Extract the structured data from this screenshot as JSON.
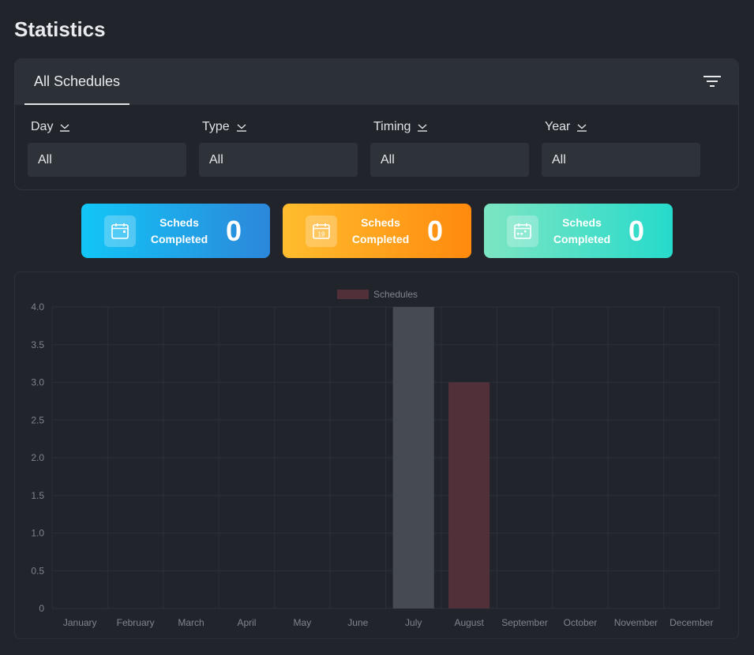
{
  "page": {
    "title": "Statistics"
  },
  "filters": {
    "tab_label": "All Schedules",
    "groups": [
      {
        "label": "Day",
        "value": "All"
      },
      {
        "label": "Type",
        "value": "All"
      },
      {
        "label": "Timing",
        "value": "All"
      },
      {
        "label": "Year",
        "value": "All"
      }
    ]
  },
  "stats": [
    {
      "label_line1": "Scheds",
      "label_line2": "Completed",
      "value": "0",
      "icon": "calendar-blank-icon"
    },
    {
      "label_line1": "Scheds",
      "label_line2": "Completed",
      "value": "0",
      "icon": "calendar-19-icon"
    },
    {
      "label_line1": "Scheds",
      "label_line2": "Completed",
      "value": "0",
      "icon": "calendar-dots-icon"
    }
  ],
  "colors": {
    "bar_july": "#464a52",
    "bar_august": "#51303a",
    "legend_swatch": "#51303a"
  },
  "chart_data": {
    "type": "bar",
    "categories": [
      "January",
      "February",
      "March",
      "April",
      "May",
      "June",
      "July",
      "August",
      "September",
      "October",
      "November",
      "December"
    ],
    "series": [
      {
        "name": "Schedules",
        "values": [
          0,
          0,
          0,
          0,
          0,
          0,
          4,
          3,
          0,
          0,
          0,
          0
        ]
      }
    ],
    "ylim": [
      0,
      4
    ],
    "yticks": [
      "0",
      "0.5",
      "1.0",
      "1.5",
      "2.0",
      "2.5",
      "3.0",
      "3.5",
      "4.0"
    ],
    "legend_position": "top",
    "grid": true
  }
}
